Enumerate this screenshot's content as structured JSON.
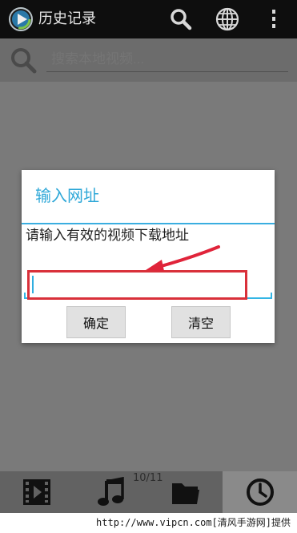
{
  "actionbar": {
    "title": "历史记录",
    "logo_icon": "media-player-logo-icon",
    "search_icon": "search-icon",
    "globe_icon": "globe-icon",
    "menu_icon": "overflow-menu-icon"
  },
  "search": {
    "placeholder": "搜索本地视频..."
  },
  "dialog": {
    "title": "输入网址",
    "message": "请输入有效的视频下载地址",
    "input_value": "",
    "ok_label": "确定",
    "clear_label": "清空",
    "accent_color": "#2fa8d8",
    "highlight_color": "#d9303a"
  },
  "bottom_nav": {
    "items": [
      {
        "icon": "video-film-icon"
      },
      {
        "icon": "music-note-icon"
      },
      {
        "icon": "folder-icon"
      },
      {
        "icon": "history-clock-icon",
        "selected": true
      }
    ],
    "page_indicator": "10/11"
  },
  "watermark": "http://www.vipcn.com[清风手游网]提供"
}
